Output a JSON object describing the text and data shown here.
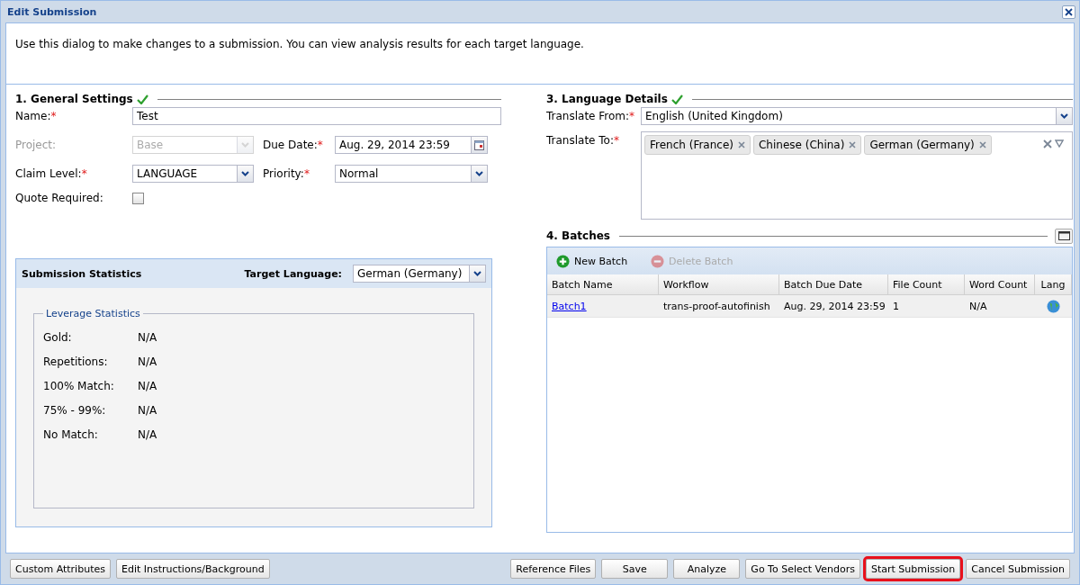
{
  "window": {
    "title": "Edit Submission"
  },
  "intro": "Use this dialog to make changes to a submission. You can view analysis results for each target language.",
  "general_settings": {
    "title": "1. General Settings",
    "valid": true,
    "rows": [
      [
        {
          "label": "Name:",
          "required_mark": "*",
          "disabled": false,
          "kind": "text",
          "value": "Test"
        }
      ],
      [
        {
          "label": "Project:",
          "disabled": true,
          "kind": "select",
          "value": "Base"
        },
        {
          "label": "Due Date:",
          "required_mark": "*",
          "disabled": false,
          "kind": "date",
          "value": "Aug. 29, 2014 23:59"
        }
      ],
      [
        {
          "label": "Claim Level:",
          "required_mark": "*",
          "disabled": false,
          "kind": "select",
          "value": "LANGUAGE"
        },
        {
          "label": "Priority:",
          "required_mark": "*",
          "disabled": false,
          "kind": "select",
          "value": "Normal"
        }
      ],
      [
        {
          "label": "Quote Required:",
          "disabled": false,
          "kind": "checkbox",
          "checked": false
        }
      ]
    ]
  },
  "submission_statistics": {
    "title": "Submission Statistics",
    "target_language_label": "Target Language:",
    "target_language": "German (Germany)",
    "leverage_statistics": {
      "title": "Leverage Statistics",
      "rows": [
        {
          "label": "Gold:",
          "value": "N/A"
        },
        {
          "label": "Repetitions:",
          "value": "N/A"
        },
        {
          "label": "100% Match:",
          "value": "N/A"
        },
        {
          "label": "75% - 99%:",
          "value": "N/A"
        },
        {
          "label": "No Match:",
          "value": "N/A"
        }
      ]
    }
  },
  "language_details": {
    "title": "3. Language Details",
    "valid": true,
    "translate_from": {
      "label": "Translate From:",
      "required_mark": "*",
      "value": "English (United Kingdom)"
    },
    "translate_to": {
      "label": "Translate To:",
      "required_mark": "*",
      "tags": [
        "French (France)",
        "Chinese (China)",
        "German (Germany)"
      ]
    }
  },
  "batches": {
    "title": "4. Batches",
    "toolbar": [
      {
        "label": "New Batch",
        "kind": "add",
        "disabled": false
      },
      {
        "label": "Delete Batch",
        "kind": "delete",
        "disabled": true
      }
    ],
    "columns": [
      "Batch Name",
      "Workflow",
      "Batch Due Date",
      "File Count",
      "Word Count",
      "Lang"
    ],
    "rows": [
      {
        "batch_name": "Batch1",
        "workflow": "trans-proof-autofinish",
        "batch_due_date": "Aug. 29, 2014 23:59",
        "file_count": "1",
        "word_count": "N/A"
      }
    ]
  },
  "footer": {
    "left_buttons": [
      {
        "label": "Custom Attributes",
        "highlighted": false
      },
      {
        "label": "Edit Instructions/Background",
        "highlighted": false
      }
    ],
    "right_buttons": [
      {
        "label": "Reference Files",
        "highlighted": false
      },
      {
        "label": "Save",
        "highlighted": false
      },
      {
        "label": "Analyze",
        "highlighted": false
      },
      {
        "label": "Go To Select Vendors",
        "highlighted": false
      },
      {
        "label": "Start Submission",
        "highlighted": true
      },
      {
        "label": "Cancel Submission",
        "highlighted": false
      }
    ]
  }
}
